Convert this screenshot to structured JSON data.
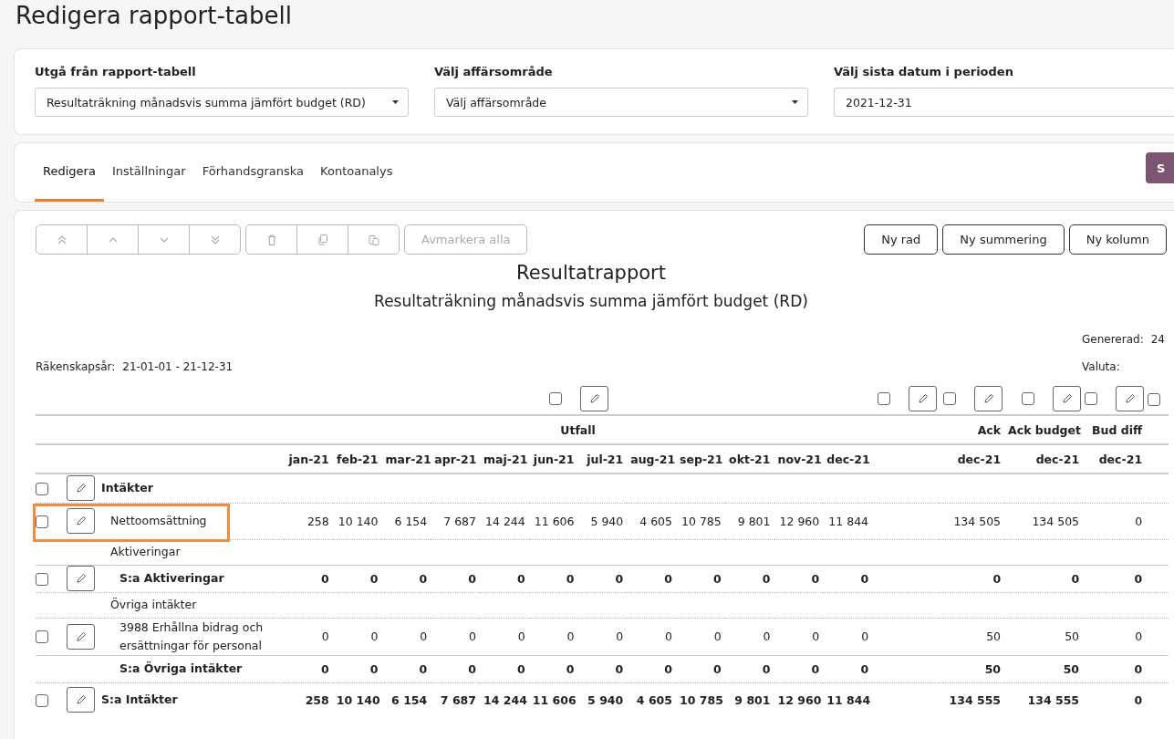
{
  "title": "Redigera rapport-tabell",
  "filters": [
    {
      "label": "Utgå från rapport-tabell",
      "kind": "select",
      "value": "Resultaträkning månadsvis summa jämfört budget (RD)"
    },
    {
      "label": "Välj affärsområde",
      "kind": "select",
      "value": "Välj affärsområde"
    },
    {
      "label": "Välj sista datum i perioden",
      "kind": "input",
      "value": "2021-12-31"
    }
  ],
  "tabs": [
    {
      "label": "Redigera",
      "selected": true
    },
    {
      "label": "Inställningar",
      "selected": false
    },
    {
      "label": "Förhandsgranska",
      "selected": false
    },
    {
      "label": "Kontoanalys",
      "selected": false
    }
  ],
  "tab_action": {
    "label": "S"
  },
  "toolbar": {
    "groups": [
      [
        {
          "kind": "top",
          "disabled": true
        },
        {
          "kind": "up",
          "disabled": true
        },
        {
          "kind": "down",
          "disabled": true
        },
        {
          "kind": "bottom",
          "disabled": true
        }
      ],
      [
        {
          "kind": "delete",
          "disabled": true
        },
        {
          "kind": "copy",
          "disabled": true
        },
        {
          "kind": "paste",
          "disabled": true
        }
      ]
    ],
    "deselect": {
      "label": "Avmarkera alla",
      "disabled": true
    },
    "actions": [
      "Ny rad",
      "Ny summering",
      "Ny kolumn"
    ]
  },
  "report": {
    "title": "Resultatrapport",
    "subtitle": "Resultaträkning månadsvis summa jämfört budget (RD)",
    "generated_label": "Genererad:",
    "generated_value": "24",
    "currency_label": "Valuta:",
    "fiscal_label": "Räkenskapsår:",
    "fiscal_value": "21-01-01 - 21-12-31"
  },
  "table": {
    "column_controls": [
      {
        "kind": "pair",
        "checked": false
      },
      {
        "kind": "pair",
        "checked": false
      },
      {
        "kind": "pair",
        "checked": false
      },
      {
        "kind": "pair",
        "checked": false
      },
      {
        "kind": "pair",
        "checked": false
      },
      {
        "kind": "checkbox",
        "checked": false
      }
    ],
    "group_heading": "Utfall",
    "months": [
      "jan-21",
      "feb-21",
      "mar-21",
      "apr-21",
      "maj-21",
      "jun-21",
      "jul-21",
      "aug-21",
      "sep-21",
      "okt-21",
      "nov-21",
      "dec-21"
    ],
    "extra_columns": [
      {
        "heading": "Ack",
        "period": "dec-21"
      },
      {
        "heading": "Ack budget",
        "period": "dec-21"
      },
      {
        "heading": "Bud diff",
        "period": "dec-21"
      }
    ],
    "rows": [
      {
        "kind": "group",
        "label": "Intäkter",
        "checked": false,
        "children": [
          {
            "kind": "account",
            "label": "Nettoomsättning",
            "checked": false,
            "highlighted": true,
            "values": [
              "258",
              "10 140",
              "6 154",
              "7 687",
              "14 244",
              "11 606",
              "5 940",
              "4 605",
              "10 785",
              "9 801",
              "12 960",
              "11 844",
              "134 505",
              "134 505",
              "0"
            ]
          },
          {
            "kind": "subgroup",
            "label": "Aktiveringar",
            "children": [
              {
                "kind": "sum",
                "label": "S:a Aktiveringar",
                "checked": false,
                "values": [
                  "0",
                  "0",
                  "0",
                  "0",
                  "0",
                  "0",
                  "0",
                  "0",
                  "0",
                  "0",
                  "0",
                  "0",
                  "0",
                  "0",
                  "0"
                ]
              }
            ]
          },
          {
            "kind": "subgroup",
            "label": "Övriga intäkter",
            "children": [
              {
                "kind": "account",
                "label": "3988 Erhållna bidrag och ersättningar för personal",
                "checked": false,
                "values": [
                  "0",
                  "0",
                  "0",
                  "0",
                  "0",
                  "0",
                  "0",
                  "0",
                  "0",
                  "0",
                  "0",
                  "0",
                  "50",
                  "50",
                  "0"
                ]
              },
              {
                "kind": "sum",
                "label": "S:a Övriga intäkter",
                "values": [
                  "0",
                  "0",
                  "0",
                  "0",
                  "0",
                  "0",
                  "0",
                  "0",
                  "0",
                  "0",
                  "0",
                  "0",
                  "50",
                  "50",
                  "0"
                ]
              }
            ]
          }
        ]
      },
      {
        "kind": "total",
        "label": "S:a Intäkter",
        "checked": false,
        "values": [
          "258",
          "10 140",
          "6 154",
          "7 687",
          "14 244",
          "11 606",
          "5 940",
          "4 605",
          "10 785",
          "9 801",
          "12 960",
          "11 844",
          "134 555",
          "134 555",
          "0"
        ]
      }
    ]
  }
}
